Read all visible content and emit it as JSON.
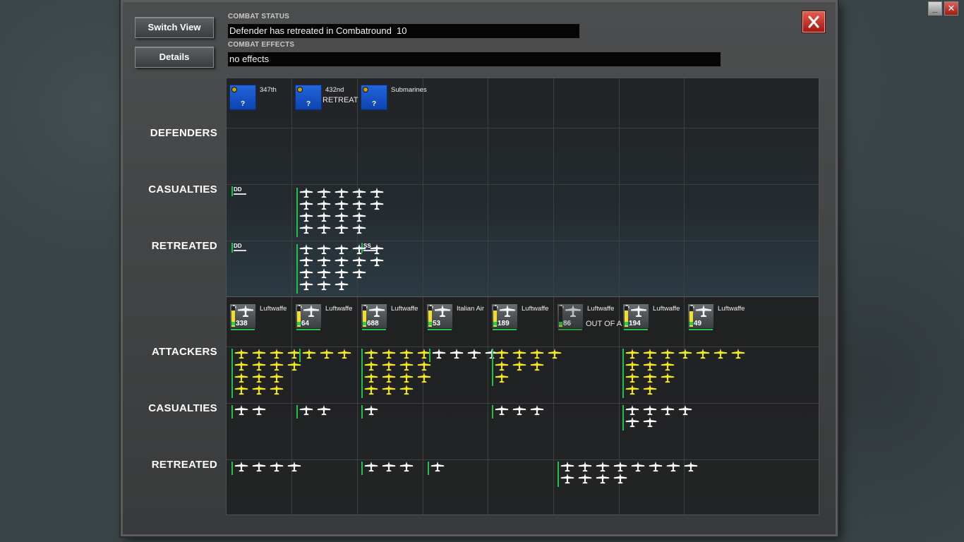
{
  "window": {
    "minimize_label": "_",
    "close_label": "✕"
  },
  "buttons": {
    "switch_view": "Switch View",
    "details": "Details"
  },
  "combat_status": {
    "label": "COMBAT STATUS",
    "value": "Defender has retreated in Combatround  10"
  },
  "combat_effects": {
    "label": "COMBAT EFFECTS",
    "value": "no effects"
  },
  "rows": {
    "defenders": "DEFENDERS",
    "def_casualties": "CASUALTIES",
    "def_retreated": "RETREATED",
    "attackers": "ATTACKERS",
    "att_casualties": "CASUALTIES",
    "att_retreated": "RETREATED"
  },
  "defender_units": [
    {
      "name": "347th",
      "count": "?",
      "status": ""
    },
    {
      "name": "432nd",
      "count": "?",
      "status": "RETREAT"
    },
    {
      "name": "Submarines",
      "count": "?",
      "status": ""
    }
  ],
  "defender_casualty_labels": {
    "destroyer": "DD"
  },
  "defender_retreat_labels": {
    "destroyer": "DD",
    "submarine": "SS"
  },
  "attacker_units": [
    {
      "name": "Luftwaffe",
      "count": "338",
      "status": "",
      "fuel": 0.8
    },
    {
      "name": "Luftwaffe",
      "count": "64",
      "status": "",
      "fuel": 0.75
    },
    {
      "name": "Luftwaffe",
      "count": "688",
      "status": "",
      "fuel": 0.8
    },
    {
      "name": "Italian Air",
      "count": "53",
      "status": "",
      "fuel": 0.8
    },
    {
      "name": "Luftwaffe",
      "count": "189",
      "status": "",
      "fuel": 0.8
    },
    {
      "name": "Luftwaffe",
      "count": "86",
      "status": "OUT OF A",
      "fuel": 0.2
    },
    {
      "name": "Luftwaffe",
      "count": "194",
      "status": "",
      "fuel": 0.8
    },
    {
      "name": "Luftwaffe",
      "count": "49",
      "status": "",
      "fuel": 0.75
    }
  ],
  "colors": {
    "highlight_plane": "#f2ea1e",
    "plane": "#ffffff",
    "navy_card": "#1a5ad0",
    "accent_green": "#22c048",
    "close_red": "#c0281c"
  },
  "icons": {
    "close": "close-icon",
    "plane": "aircraft-icon",
    "ship": "ship-icon",
    "minimize": "minimize-icon"
  }
}
